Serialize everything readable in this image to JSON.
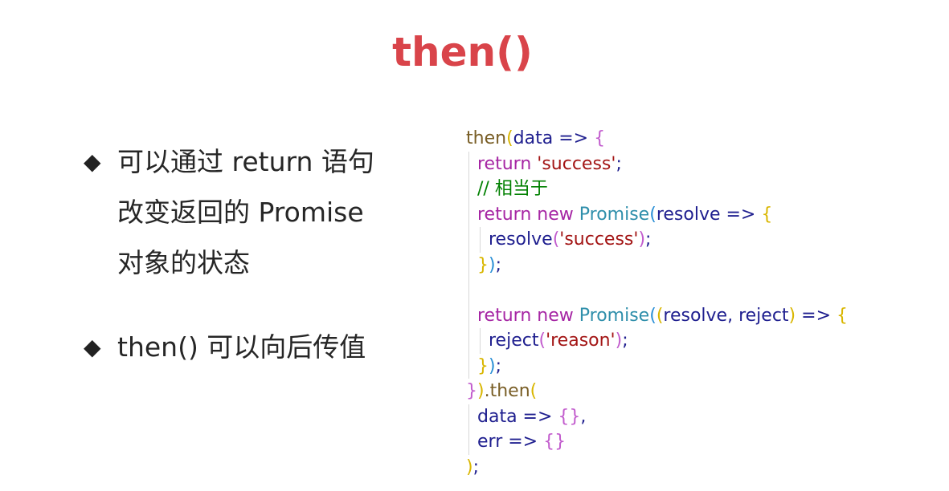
{
  "slide": {
    "title": "then()",
    "bullet_icon": "diamond-bullet-icon",
    "bullets": [
      {
        "text": "可以通过 return 语句改变返回的 Promise 对象的状态"
      },
      {
        "text": "then() 可以向后传值"
      }
    ]
  },
  "code": {
    "lines": [
      {
        "indent": 0,
        "tokens": [
          [
            "then",
            "fn"
          ],
          [
            "(",
            "br1"
          ],
          [
            "data",
            "var"
          ],
          [
            " => ",
            "op"
          ],
          [
            "{",
            "br2"
          ]
        ]
      },
      {
        "indent": 1,
        "tokens": [
          [
            "return",
            "kw"
          ],
          [
            " ",
            "plain"
          ],
          [
            "'success'",
            "str"
          ],
          [
            ";",
            "plain"
          ]
        ]
      },
      {
        "indent": 1,
        "tokens": [
          [
            "// 相当于",
            "cmt"
          ]
        ]
      },
      {
        "indent": 1,
        "tokens": [
          [
            "return",
            "kw"
          ],
          [
            " ",
            "plain"
          ],
          [
            "new",
            "kw"
          ],
          [
            " ",
            "plain"
          ],
          [
            "Promise",
            "cls"
          ],
          [
            "(",
            "br3"
          ],
          [
            "resolve",
            "var"
          ],
          [
            " => ",
            "op"
          ],
          [
            "{",
            "br1"
          ]
        ]
      },
      {
        "indent": 2,
        "tokens": [
          [
            "resolve",
            "var"
          ],
          [
            "(",
            "br2"
          ],
          [
            "'success'",
            "str"
          ],
          [
            ")",
            "br2"
          ],
          [
            ";",
            "plain"
          ]
        ]
      },
      {
        "indent": 1,
        "tokens": [
          [
            "}",
            "br1"
          ],
          [
            ")",
            "br3"
          ],
          [
            ";",
            "plain"
          ]
        ]
      },
      {
        "indent": 1,
        "tokens": []
      },
      {
        "indent": 1,
        "tokens": [
          [
            "return",
            "kw"
          ],
          [
            " ",
            "plain"
          ],
          [
            "new",
            "kw"
          ],
          [
            " ",
            "plain"
          ],
          [
            "Promise",
            "cls"
          ],
          [
            "(",
            "br3"
          ],
          [
            "(",
            "br1"
          ],
          [
            "resolve, reject",
            "var"
          ],
          [
            ")",
            "br1"
          ],
          [
            " => ",
            "op"
          ],
          [
            "{",
            "br1"
          ]
        ]
      },
      {
        "indent": 2,
        "tokens": [
          [
            "reject",
            "var"
          ],
          [
            "(",
            "br2"
          ],
          [
            "'reason'",
            "str"
          ],
          [
            ")",
            "br2"
          ],
          [
            ";",
            "plain"
          ]
        ]
      },
      {
        "indent": 1,
        "tokens": [
          [
            "}",
            "br1"
          ],
          [
            ")",
            "br3"
          ],
          [
            ";",
            "plain"
          ]
        ]
      },
      {
        "indent": 0,
        "tokens": [
          [
            "}",
            "br2"
          ],
          [
            ")",
            "br1"
          ],
          [
            ".then",
            "fn"
          ],
          [
            "(",
            "br1"
          ]
        ]
      },
      {
        "indent": 1,
        "tokens": [
          [
            "data",
            "var"
          ],
          [
            " => ",
            "op"
          ],
          [
            "{}",
            "br2"
          ],
          [
            ",",
            "plain"
          ]
        ]
      },
      {
        "indent": 1,
        "tokens": [
          [
            "err",
            "var"
          ],
          [
            " => ",
            "op"
          ],
          [
            "{}",
            "br2"
          ]
        ]
      },
      {
        "indent": 0,
        "tokens": [
          [
            ")",
            "br1"
          ],
          [
            ";",
            "plain"
          ]
        ]
      }
    ]
  },
  "colors": {
    "title": "#d9444a",
    "body_text": "#262626",
    "keyword": "#a626a4",
    "string": "#a31515",
    "class": "#2f8fab",
    "comment": "#008000",
    "function": "#795e26",
    "variable": "#1f1f8f",
    "bracket_gold": "#d9b600",
    "bracket_purple": "#c25ccd",
    "bracket_blue": "#2a8fd6"
  }
}
